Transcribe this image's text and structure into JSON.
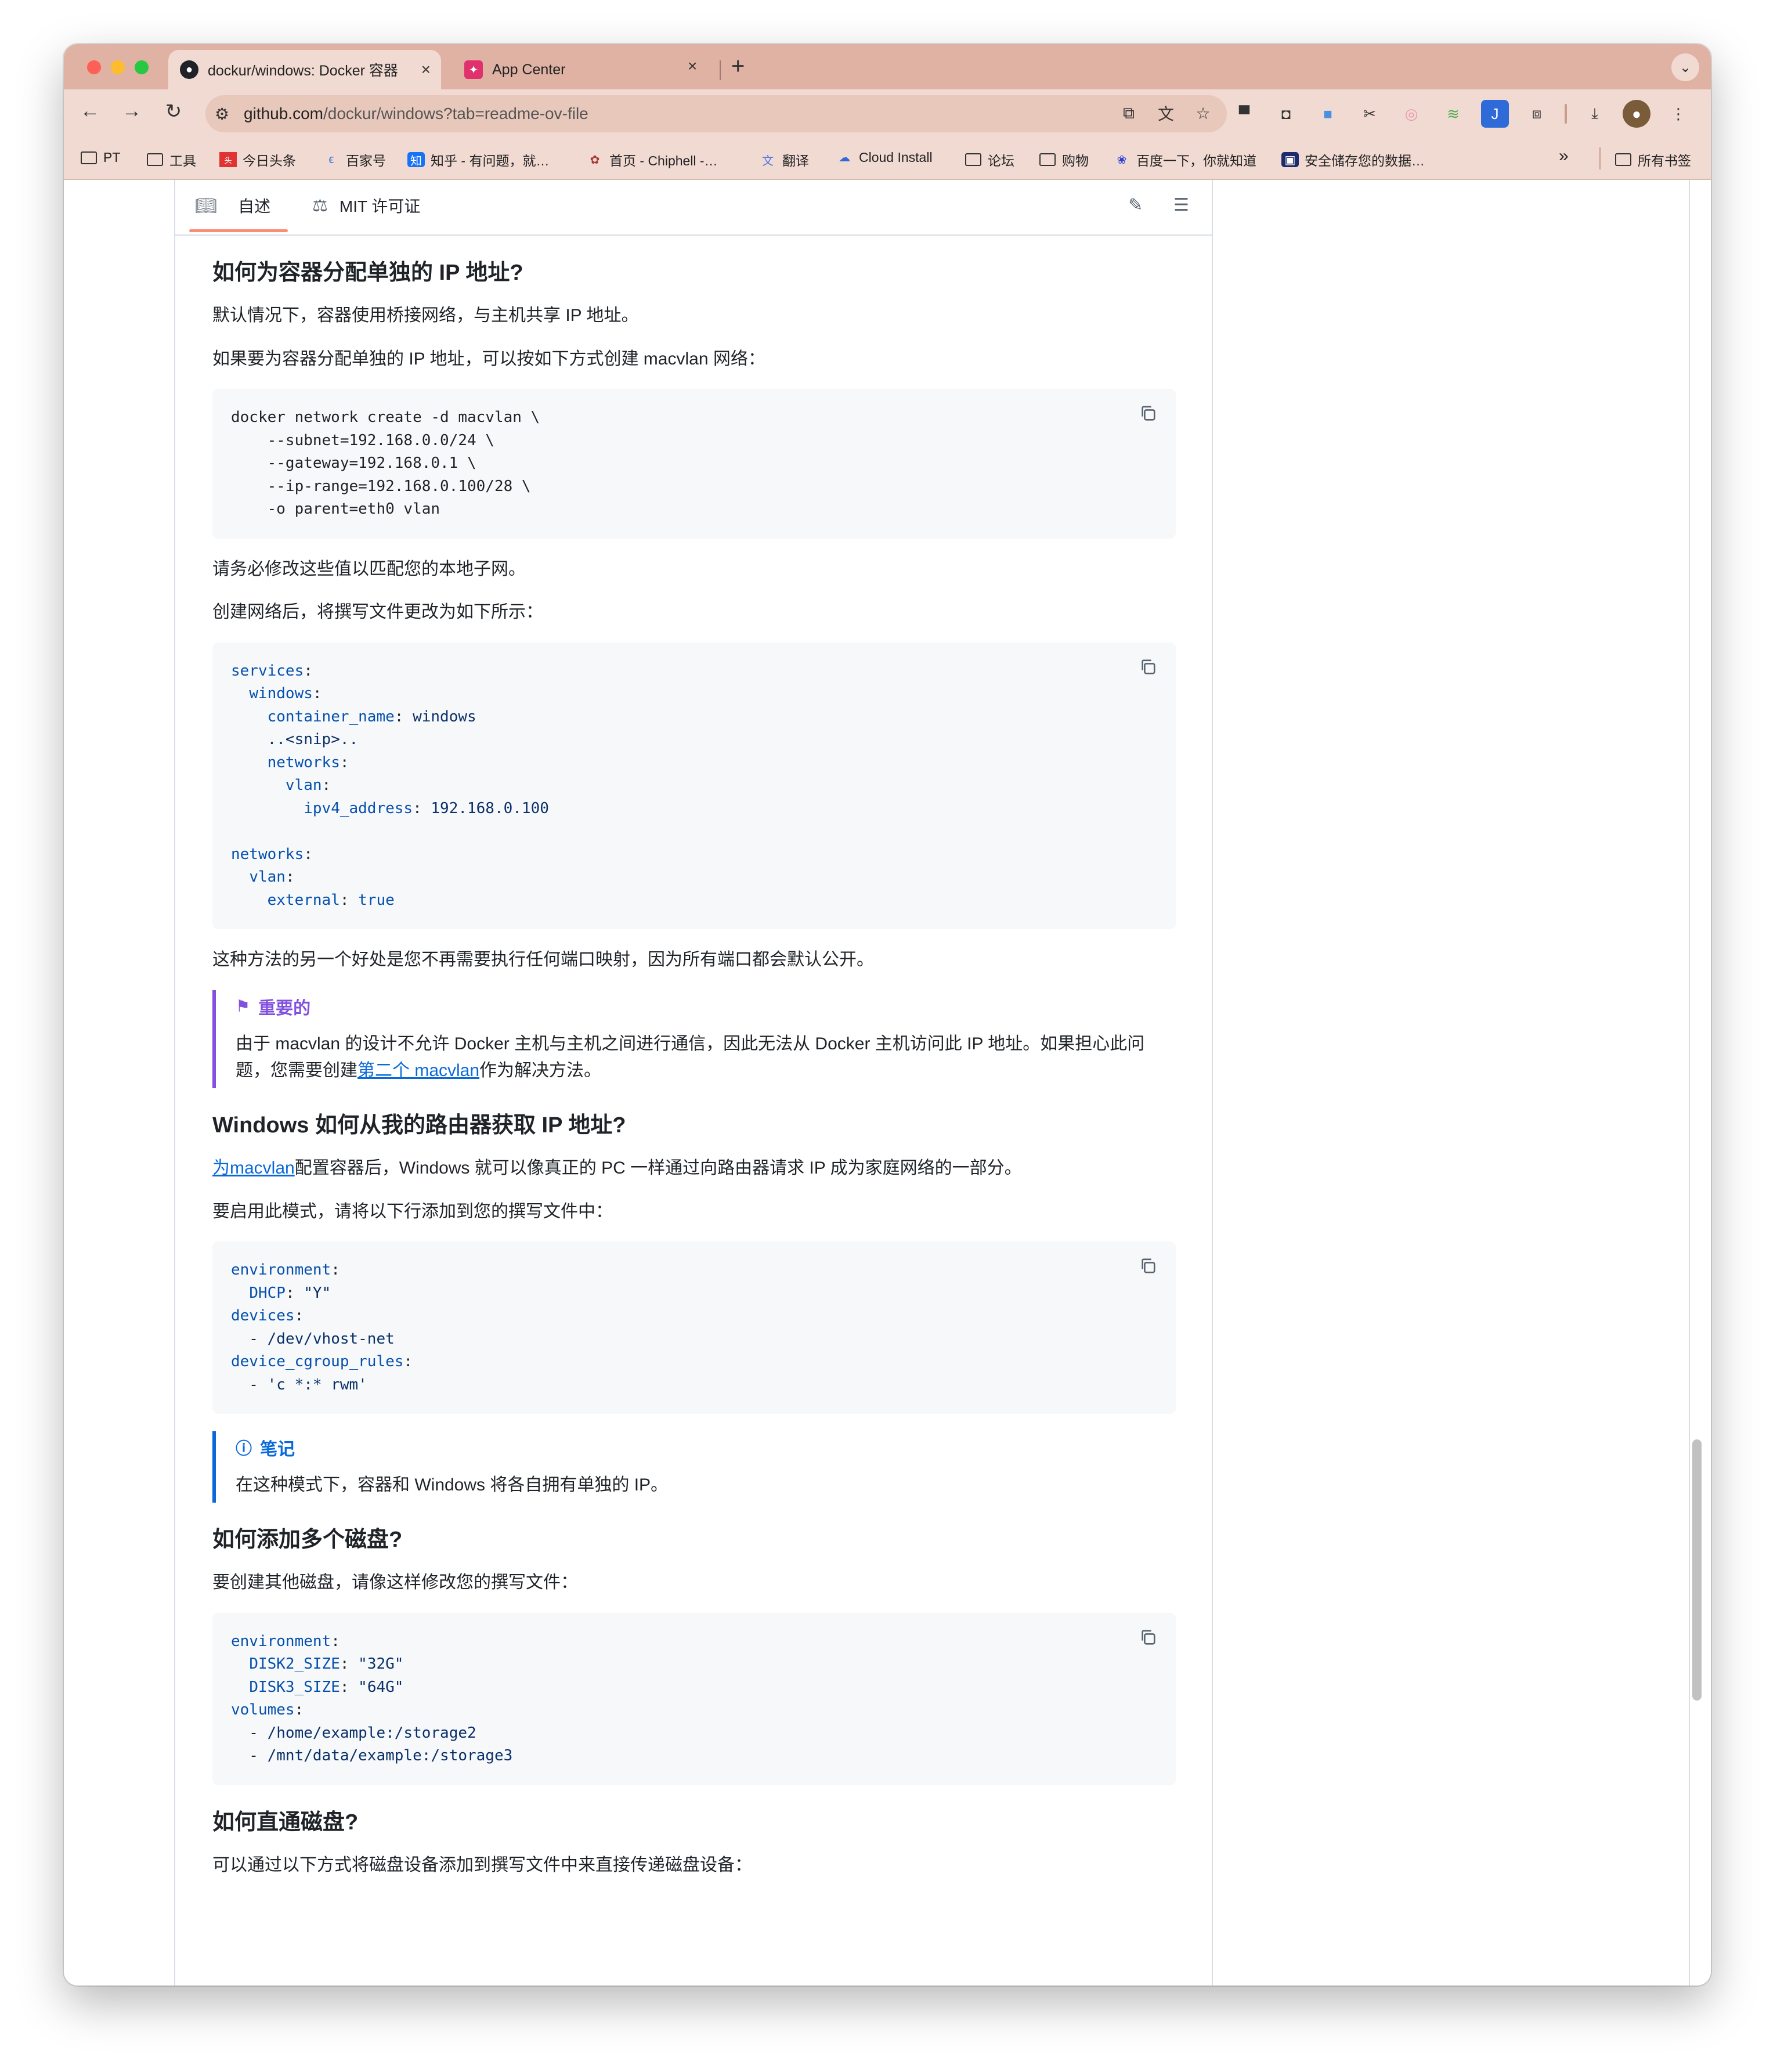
{
  "browser": {
    "tabs": [
      {
        "title": "dockur/windows: Docker 容器",
        "close": "×"
      },
      {
        "title": "App Center",
        "close": "×"
      }
    ],
    "new_tab": "+",
    "url_host": "github.com",
    "url_path": "/dockur/windows?tab=readme-ov-file",
    "bookmarks": [
      "PT",
      "工具",
      "今日头条",
      "百家号",
      "知乎 - 有问题，就…",
      "首页 - Chiphell -…",
      "翻译",
      "Cloud Install",
      "论坛",
      "购物",
      "百度一下，你就知道",
      "安全储存您的数据…"
    ],
    "bookmarks_more": "»",
    "all_bookmarks": "所有书签"
  },
  "readme": {
    "tab_readme": "自述",
    "tab_license": "MIT 许可证"
  },
  "article": {
    "h_ip": "如何为容器分配单独的 IP 地址?",
    "p_default": "默认情况下，容器使用桥接网络，与主机共享 IP 地址。",
    "p_macvlan": "如果要为容器分配单独的 IP 地址，可以按如下方式创建 macvlan 网络：",
    "code1": [
      "docker network create -d macvlan \\",
      "    --subnet=192.168.0.0/24 \\",
      "    --gateway=192.168.0.1 \\",
      "    --ip-range=192.168.0.100/28 \\",
      "    -o parent=eth0 vlan"
    ],
    "p_modify": "请务必修改这些值以匹配您的本地子网。",
    "p_after": "创建网络后，将撰写文件更改为如下所示：",
    "p_benefit": "这种方法的另一个好处是您不再需要执行任何端口映射，因为所有端口都会默认公开。",
    "important_title": "重要的",
    "important_text_a": "由于 macvlan 的设计不允许 Docker 主机与主机之间进行通信，因此无法从 Docker 主机访问此 IP 地址。如果担心此问题，您需要创建",
    "important_link": "第二个 macvlan",
    "important_text_b": "作为解决方法。",
    "h_dhcp": "Windows 如何从我的路由器获取 IP 地址?",
    "dhcp_link": "为macvlan",
    "dhcp_text": "配置容器后，Windows 就可以像真正的 PC 一样通过向路由器请求 IP 成为家庭网络的一部分。",
    "p_enable": "要启用此模式，请将以下行添加到您的撰写文件中：",
    "note_title": "笔记",
    "note_text": "在这种模式下，容器和 Windows 将各自拥有单独的 IP。",
    "h_disks": "如何添加多个磁盘?",
    "p_disks": "要创建其他磁盘，请像这样修改您的撰写文件：",
    "h_passthrough": "如何直通磁盘?",
    "p_passthrough": "可以通过以下方式将磁盘设备添加到撰写文件中来直接传递磁盘设备："
  },
  "colors": {
    "tabbar": "#dfb2a3",
    "toolbar": "#f1dad2",
    "link": "#0969da",
    "important": "#8250df",
    "note": "#0969da",
    "code_bg": "#f6f8fa"
  }
}
